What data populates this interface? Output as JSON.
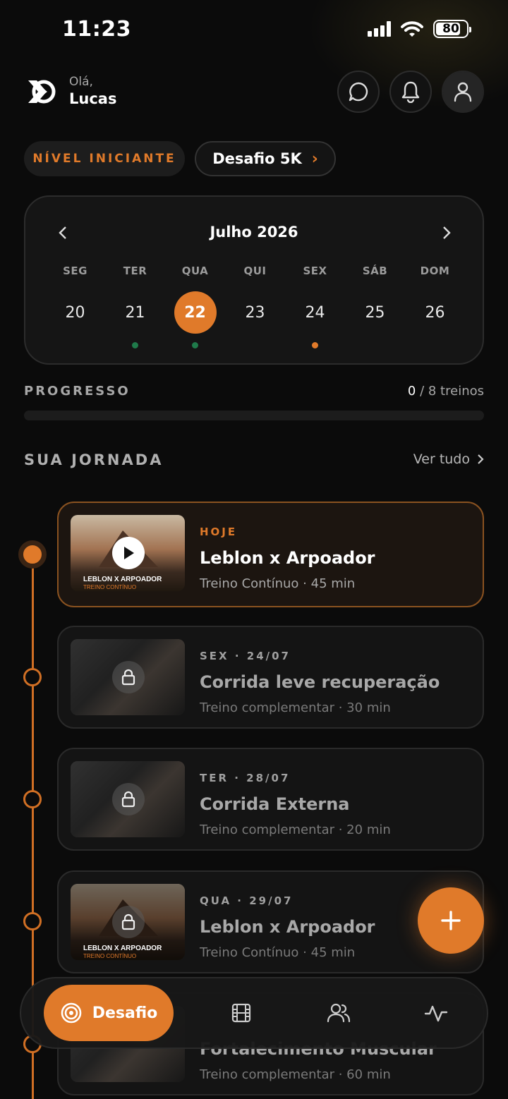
{
  "status_bar": {
    "time": "11:23",
    "battery": "80"
  },
  "header": {
    "greeting": "Olá,",
    "user_name": "Lucas"
  },
  "chips": {
    "level": "NÍVEL INICIANTE",
    "challenge": "Desafio 5K"
  },
  "calendar": {
    "month": "Julho 2026",
    "days": [
      {
        "dow": "SEG",
        "num": "20",
        "selected": false,
        "dot": "none"
      },
      {
        "dow": "TER",
        "num": "21",
        "selected": false,
        "dot": "green"
      },
      {
        "dow": "QUA",
        "num": "22",
        "selected": true,
        "dot": "green"
      },
      {
        "dow": "QUI",
        "num": "23",
        "selected": false,
        "dot": "none"
      },
      {
        "dow": "SEX",
        "num": "24",
        "selected": false,
        "dot": "orange"
      },
      {
        "dow": "SÁB",
        "num": "25",
        "selected": false,
        "dot": "none"
      },
      {
        "dow": "DOM",
        "num": "26",
        "selected": false,
        "dot": "none"
      }
    ]
  },
  "progress": {
    "label": "PROGRESSO",
    "done": "0",
    "total": "/ 8 treinos",
    "fraction": 0
  },
  "journey": {
    "title": "SUA JORNADA",
    "see_all": "Ver tudo",
    "items": [
      {
        "tag": "HOJE",
        "title": "Leblon x Arpoador",
        "sub": "Treino Contínuo · 45 min",
        "thumb_caption": "LEBLON X ARPOADOR",
        "thumb_sub": "TREINO CONTÍNUO"
      },
      {
        "tag": "SEX · 24/07",
        "title": "Corrida leve recuperação",
        "sub": "Treino complementar · 30 min"
      },
      {
        "tag": "TER · 28/07",
        "title": "Corrida Externa",
        "sub": "Treino complementar · 20 min"
      },
      {
        "tag": "QUA · 29/07",
        "title": "Leblon x Arpoador",
        "sub": "Treino Contínuo · 45 min",
        "thumb_caption": "LEBLON X ARPOADOR",
        "thumb_sub": "TREINO CONTÍNUO"
      },
      {
        "tag": "",
        "title": "Fortalecimento Muscular",
        "sub": "Treino complementar · 60 min"
      }
    ]
  },
  "bottom_nav": {
    "active_label": "Desafio",
    "items": [
      "target-icon",
      "film-icon",
      "users-icon",
      "activity-icon"
    ]
  },
  "colors": {
    "accent": "#e07a2a",
    "background": "#0b0b0b",
    "done_dot": "#1f7a4a"
  }
}
